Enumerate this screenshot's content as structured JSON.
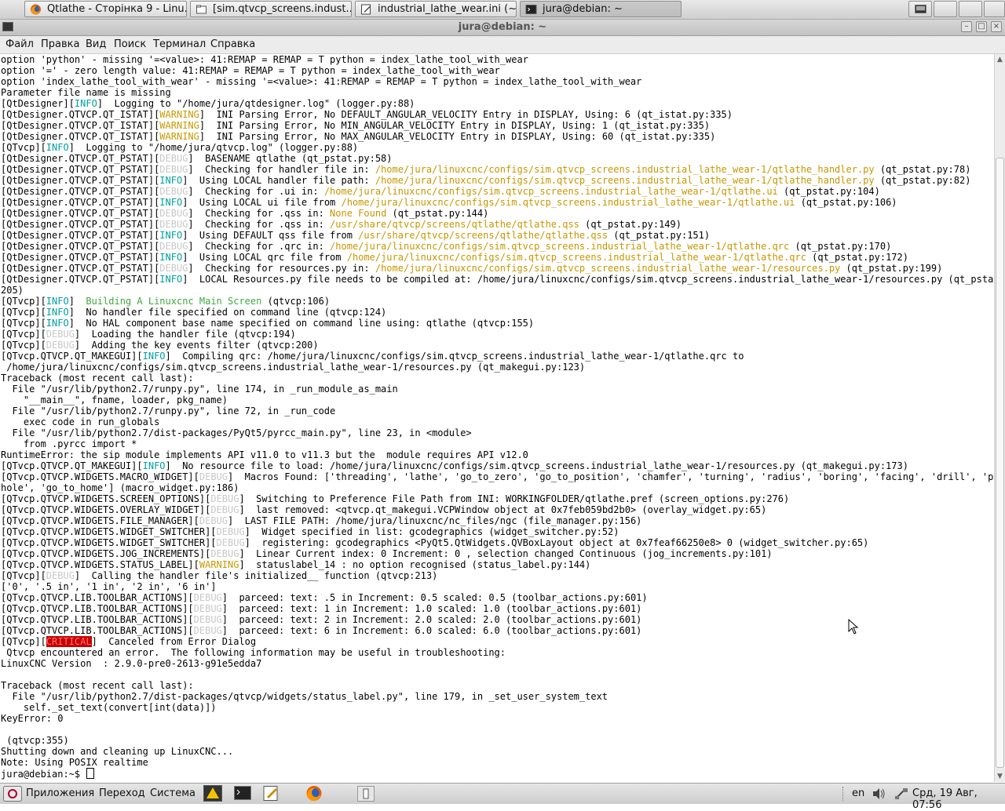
{
  "taskbar": {
    "tasks": [
      {
        "label": "Qtlathe - Сторінка 9 - Linu...",
        "icon": "firefox-icon"
      },
      {
        "label": "[sim.qtvcp_screens.indust...",
        "icon": "folder-icon"
      },
      {
        "label": "industrial_lathe_wear.ini (~...",
        "icon": "text-editor-icon"
      },
      {
        "label": "jura@debian: ~",
        "icon": "terminal-icon"
      }
    ]
  },
  "window": {
    "title": "jura@debian: ~"
  },
  "menubar": {
    "items": [
      "Файл",
      "Правка",
      "Вид",
      "Поиск",
      "Терминал",
      "Справка"
    ]
  },
  "terminal": {
    "lines": [
      [
        {
          "t": "option 'python' - missing '=<value>: 41:REMAP = REMAP = T python = index_lathe_tool_with_wear"
        }
      ],
      [
        {
          "t": "option '=' - zero length value: 41:REMAP = REMAP = T python = index_lathe_tool_with_wear"
        }
      ],
      [
        {
          "t": "option 'index_lathe_tool_with_wear' - missing '=<value>: 41:REMAP = REMAP = T python = index_lathe_tool_with_wear"
        }
      ],
      [
        {
          "t": "Parameter file name is missing"
        }
      ],
      [
        {
          "t": "[QtDesigner]["
        },
        {
          "t": "INFO",
          "c": "info"
        },
        {
          "t": "]  Logging to \"/home/jura/qtdesigner.log\" (logger.py:88)"
        }
      ],
      [
        {
          "t": "[QtDesigner.QTVCP.QT_ISTAT]["
        },
        {
          "t": "WARNING",
          "c": "warn"
        },
        {
          "t": "]  INI Parsing Error, No DEFAULT_ANGULAR_VELOCITY Entry in DISPLAY, Using: 6 (qt_istat.py:335)"
        }
      ],
      [
        {
          "t": "[QtDesigner.QTVCP.QT_ISTAT]["
        },
        {
          "t": "WARNING",
          "c": "warn"
        },
        {
          "t": "]  INI Parsing Error, No MIN_ANGULAR_VELOCITY Entry in DISPLAY, Using: 1 (qt_istat.py:335)"
        }
      ],
      [
        {
          "t": "[QtDesigner.QTVCP.QT_ISTAT]["
        },
        {
          "t": "WARNING",
          "c": "warn"
        },
        {
          "t": "]  INI Parsing Error, No MAX_ANGULAR_VELOCITY Entry in DISPLAY, Using: 60 (qt_istat.py:335)"
        }
      ],
      [
        {
          "t": "[QTvcp]["
        },
        {
          "t": "INFO",
          "c": "info"
        },
        {
          "t": "]  Logging to \"/home/jura/qtvcp.log\" (logger.py:88)"
        }
      ],
      [
        {
          "t": "[QtDesigner.QTVCP.QT_PSTAT]["
        },
        {
          "t": "DEBUG",
          "c": "debug"
        },
        {
          "t": "]  BASENAME qtlathe (qt_pstat.py:58)"
        }
      ],
      [
        {
          "t": "[QtDesigner.QTVCP.QT_PSTAT]["
        },
        {
          "t": "DEBUG",
          "c": "debug"
        },
        {
          "t": "]  Checking for handler file in: "
        },
        {
          "t": "/home/jura/linuxcnc/configs/sim.qtvcp_screens.industrial_lathe_wear-1/qtlathe_handler.py",
          "c": "path"
        },
        {
          "t": " (qt_pstat.py:78)"
        }
      ],
      [
        {
          "t": "[QtDesigner.QTVCP.QT_PSTAT]["
        },
        {
          "t": "INFO",
          "c": "info"
        },
        {
          "t": "]  Using LOCAL handler file path: "
        },
        {
          "t": "/home/jura/linuxcnc/configs/sim.qtvcp_screens.industrial_lathe_wear-1/qtlathe_handler.py",
          "c": "path"
        },
        {
          "t": " (qt_pstat.py:82)"
        }
      ],
      [
        {
          "t": "[QtDesigner.QTVCP.QT_PSTAT]["
        },
        {
          "t": "DEBUG",
          "c": "debug"
        },
        {
          "t": "]  Checking for .ui in: "
        },
        {
          "t": "/home/jura/linuxcnc/configs/sim.qtvcp_screens.industrial_lathe_wear-1/qtlathe.ui",
          "c": "path"
        },
        {
          "t": " (qt_pstat.py:104)"
        }
      ],
      [
        {
          "t": "[QtDesigner.QTVCP.QT_PSTAT]["
        },
        {
          "t": "INFO",
          "c": "info"
        },
        {
          "t": "]  Using LOCAL ui file from "
        },
        {
          "t": "/home/jura/linuxcnc/configs/sim.qtvcp_screens.industrial_lathe_wear-1/qtlathe.ui",
          "c": "path"
        },
        {
          "t": " (qt_pstat.py:106)"
        }
      ],
      [
        {
          "t": "[QtDesigner.QTVCP.QT_PSTAT]["
        },
        {
          "t": "DEBUG",
          "c": "debug"
        },
        {
          "t": "]  Checking for .qss in: "
        },
        {
          "t": "None Found",
          "c": "path"
        },
        {
          "t": " (qt_pstat.py:144)"
        }
      ],
      [
        {
          "t": "[QtDesigner.QTVCP.QT_PSTAT]["
        },
        {
          "t": "DEBUG",
          "c": "debug"
        },
        {
          "t": "]  Checking for .qss in: "
        },
        {
          "t": "/usr/share/qtvcp/screens/qtlathe/qtlathe.qss",
          "c": "path"
        },
        {
          "t": " (qt_pstat.py:149)"
        }
      ],
      [
        {
          "t": "[QtDesigner.QTVCP.QT_PSTAT]["
        },
        {
          "t": "INFO",
          "c": "info"
        },
        {
          "t": "]  Using DEFAULT qss file from "
        },
        {
          "t": "/usr/share/qtvcp/screens/qtlathe/qtlathe.qss",
          "c": "path"
        },
        {
          "t": " (qt_pstat.py:151)"
        }
      ],
      [
        {
          "t": "[QtDesigner.QTVCP.QT_PSTAT]["
        },
        {
          "t": "DEBUG",
          "c": "debug"
        },
        {
          "t": "]  Checking for .qrc in: "
        },
        {
          "t": "/home/jura/linuxcnc/configs/sim.qtvcp_screens.industrial_lathe_wear-1/qtlathe.qrc",
          "c": "path"
        },
        {
          "t": " (qt_pstat.py:170)"
        }
      ],
      [
        {
          "t": "[QtDesigner.QTVCP.QT_PSTAT]["
        },
        {
          "t": "INFO",
          "c": "info"
        },
        {
          "t": "]  Using LOCAL qrc file from "
        },
        {
          "t": "/home/jura/linuxcnc/configs/sim.qtvcp_screens.industrial_lathe_wear-1/qtlathe.qrc",
          "c": "path"
        },
        {
          "t": " (qt_pstat.py:172)"
        }
      ],
      [
        {
          "t": "[QtDesigner.QTVCP.QT_PSTAT]["
        },
        {
          "t": "DEBUG",
          "c": "debug"
        },
        {
          "t": "]  Checking for resources.py in: "
        },
        {
          "t": "/home/jura/linuxcnc/configs/sim.qtvcp_screens.industrial_lathe_wear-1/resources.py",
          "c": "path"
        },
        {
          "t": " (qt_pstat.py:199)"
        }
      ],
      [
        {
          "t": "[QtDesigner.QTVCP.QT_PSTAT]["
        },
        {
          "t": "INFO",
          "c": "info"
        },
        {
          "t": "]  LOCAL Resources.py file needs to be compiled at: /home/jura/linuxcnc/configs/sim.qtvcp_screens.industrial_lathe_wear-1/resources.py (qt_pstat.py:"
        }
      ],
      [
        {
          "t": "205)"
        }
      ],
      [
        {
          "t": "[QTvcp]["
        },
        {
          "t": "INFO",
          "c": "info"
        },
        {
          "t": "]  "
        },
        {
          "t": "Building A Linuxcnc Main Screen",
          "c": "green"
        },
        {
          "t": " (qtvcp:106)"
        }
      ],
      [
        {
          "t": "[QTvcp]["
        },
        {
          "t": "INFO",
          "c": "info"
        },
        {
          "t": "]  No handler file specified on command line (qtvcp:124)"
        }
      ],
      [
        {
          "t": "[QTvcp]["
        },
        {
          "t": "INFO",
          "c": "info"
        },
        {
          "t": "]  No HAL component base name specified on command line using: qtlathe (qtvcp:155)"
        }
      ],
      [
        {
          "t": "[QTvcp]["
        },
        {
          "t": "DEBUG",
          "c": "debug"
        },
        {
          "t": "]  Loading the handler file (qtvcp:194)"
        }
      ],
      [
        {
          "t": "[QTvcp]["
        },
        {
          "t": "DEBUG",
          "c": "debug"
        },
        {
          "t": "]  Adding the key events filter (qtvcp:200)"
        }
      ],
      [
        {
          "t": "[QTvcp.QTVCP.QT_MAKEGUI]["
        },
        {
          "t": "INFO",
          "c": "info"
        },
        {
          "t": "]  Compiling qrc: /home/jura/linuxcnc/configs/sim.qtvcp_screens.industrial_lathe_wear-1/qtlathe.qrc to"
        }
      ],
      [
        {
          "t": " /home/jura/linuxcnc/configs/sim.qtvcp_screens.industrial_lathe_wear-1/resources.py (qt_makegui.py:123)"
        }
      ],
      [
        {
          "t": "Traceback (most recent call last):"
        }
      ],
      [
        {
          "t": "  File \"/usr/lib/python2.7/runpy.py\", line 174, in _run_module_as_main"
        }
      ],
      [
        {
          "t": "    \"__main__\", fname, loader, pkg_name)"
        }
      ],
      [
        {
          "t": "  File \"/usr/lib/python2.7/runpy.py\", line 72, in _run_code"
        }
      ],
      [
        {
          "t": "    exec code in run_globals"
        }
      ],
      [
        {
          "t": "  File \"/usr/lib/python2.7/dist-packages/PyQt5/pyrcc_main.py\", line 23, in <module>"
        }
      ],
      [
        {
          "t": "    from .pyrcc import *"
        }
      ],
      [
        {
          "t": "RuntimeError: the sip module implements API v11.0 to v11.3 but the  module requires API v12.0"
        }
      ],
      [
        {
          "t": "[QTvcp.QTVCP.QT_MAKEGUI]["
        },
        {
          "t": "INFO",
          "c": "info"
        },
        {
          "t": "]  No resource file to load: /home/jura/linuxcnc/configs/sim.qtvcp_screens.industrial_lathe_wear-1/resources.py (qt_makegui.py:173)"
        }
      ],
      [
        {
          "t": "[QTvcp.QTVCP.WIDGETS.MACRO_WIDGET]["
        },
        {
          "t": "DEBUG",
          "c": "debug"
        },
        {
          "t": "]  Macros Found: ['threading', 'lathe', 'go_to_zero', 'go_to_position', 'chamfer', 'turning', 'radius', 'boring', 'facing', 'drill', 'probe-"
        }
      ],
      [
        {
          "t": "hole', 'go_to_home'] (macro_widget.py:186)"
        }
      ],
      [
        {
          "t": "[QTvcp.QTVCP.WIDGETS.SCREEN_OPTIONS]["
        },
        {
          "t": "DEBUG",
          "c": "debug"
        },
        {
          "t": "]  Switching to Preference File Path from INI: WORKINGFOLDER/qtlathe.pref (screen_options.py:276)"
        }
      ],
      [
        {
          "t": "[QTvcp.QTVCP.WIDGETS.OVERLAY_WIDGET]["
        },
        {
          "t": "DEBUG",
          "c": "debug"
        },
        {
          "t": "]  last removed: <qtvcp.qt_makegui.VCPWindow object at 0x7feb059bd2b0> (overlay_widget.py:65)"
        }
      ],
      [
        {
          "t": "[QTvcp.QTVCP.WIDGETS.FILE_MANAGER]["
        },
        {
          "t": "DEBUG",
          "c": "debug"
        },
        {
          "t": "]  LAST FILE PATH: /home/jura/linuxcnc/nc_files/ngc (file_manager.py:156)"
        }
      ],
      [
        {
          "t": "[QTvcp.QTVCP.WIDGETS.WIDGET_SWITCHER]["
        },
        {
          "t": "DEBUG",
          "c": "debug"
        },
        {
          "t": "]  Widget specified in list: gcodegraphics (widget_switcher.py:52)"
        }
      ],
      [
        {
          "t": "[QTvcp.QTVCP.WIDGETS.WIDGET_SWITCHER]["
        },
        {
          "t": "DEBUG",
          "c": "debug"
        },
        {
          "t": "]  registering: gcodegraphics <PyQt5.QtWidgets.QVBoxLayout object at 0x7feaf66250e8> 0 (widget_switcher.py:65)"
        }
      ],
      [
        {
          "t": "[QTvcp.QTVCP.WIDGETS.JOG_INCREMENTS]["
        },
        {
          "t": "DEBUG",
          "c": "debug"
        },
        {
          "t": "]  Linear Current index: 0 Increment: 0 , selection changed Continuous (jog_increments.py:101)"
        }
      ],
      [
        {
          "t": "[QTvcp.QTVCP.WIDGETS.STATUS_LABEL]["
        },
        {
          "t": "WARNING",
          "c": "warn"
        },
        {
          "t": "]  statuslabel_14 : no option recognised (status_label.py:144)"
        }
      ],
      [
        {
          "t": "[QTvcp]["
        },
        {
          "t": "DEBUG",
          "c": "debug"
        },
        {
          "t": "]  Calling the handler file's initialized__ function (qtvcp:213)"
        }
      ],
      [
        {
          "t": "['0', '.5 in', '1 in', '2 in', '6 in']"
        }
      ],
      [
        {
          "t": "[QTvcp.QTVCP.LIB.TOOLBAR_ACTIONS]["
        },
        {
          "t": "DEBUG",
          "c": "debug"
        },
        {
          "t": "]  parceed: text: .5 in Increment: 0.5 scaled: 0.5 (toolbar_actions.py:601)"
        }
      ],
      [
        {
          "t": "[QTvcp.QTVCP.LIB.TOOLBAR_ACTIONS]["
        },
        {
          "t": "DEBUG",
          "c": "debug"
        },
        {
          "t": "]  parceed: text: 1 in Increment: 1.0 scaled: 1.0 (toolbar_actions.py:601)"
        }
      ],
      [
        {
          "t": "[QTvcp.QTVCP.LIB.TOOLBAR_ACTIONS]["
        },
        {
          "t": "DEBUG",
          "c": "debug"
        },
        {
          "t": "]  parceed: text: 2 in Increment: 2.0 scaled: 2.0 (toolbar_actions.py:601)"
        }
      ],
      [
        {
          "t": "[QTvcp.QTVCP.LIB.TOOLBAR_ACTIONS]["
        },
        {
          "t": "DEBUG",
          "c": "debug"
        },
        {
          "t": "]  parceed: text: 6 in Increment: 6.0 scaled: 6.0 (toolbar_actions.py:601)"
        }
      ],
      [
        {
          "t": "[QTvcp]["
        },
        {
          "t": "CRITICAL",
          "c": "crit"
        },
        {
          "t": "]  Canceled from Error Dialog"
        }
      ],
      [
        {
          "t": " Qtvcp encountered an error.  The following information may be useful in troubleshooting:"
        }
      ],
      [
        {
          "t": "LinuxCNC Version  : 2.9.0-pre0-2613-g91e5edda7"
        }
      ],
      [
        {
          "t": ""
        }
      ],
      [
        {
          "t": "Traceback (most recent call last):"
        }
      ],
      [
        {
          "t": "  File \"/usr/lib/python2.7/dist-packages/qtvcp/widgets/status_label.py\", line 179, in _set_user_system_text"
        }
      ],
      [
        {
          "t": "    self._set_text(convert[int(data)])"
        }
      ],
      [
        {
          "t": "KeyError: 0"
        }
      ],
      [
        {
          "t": ""
        }
      ],
      [
        {
          "t": " (qtvcp:355)"
        }
      ],
      [
        {
          "t": "Shutting down and cleaning up LinuxCNC..."
        }
      ],
      [
        {
          "t": "Note: Using POSIX realtime"
        }
      ]
    ],
    "prompt": "jura@debian:~$ "
  },
  "panel": {
    "menus": [
      "Приложения",
      "Переход",
      "Система"
    ],
    "launchers": [
      "linuxcnc-icon",
      "terminal-icon",
      "text-editor-icon",
      "firefox-icon"
    ],
    "language": "en",
    "clock": "Срд, 19 Авг, 07:56"
  },
  "colors": {
    "info": "#00a0a0",
    "debug": "#c8c8c8",
    "warning": "#c89a00",
    "path": "#c89600",
    "success": "#3fa83f",
    "critical_bg": "#c80000"
  }
}
